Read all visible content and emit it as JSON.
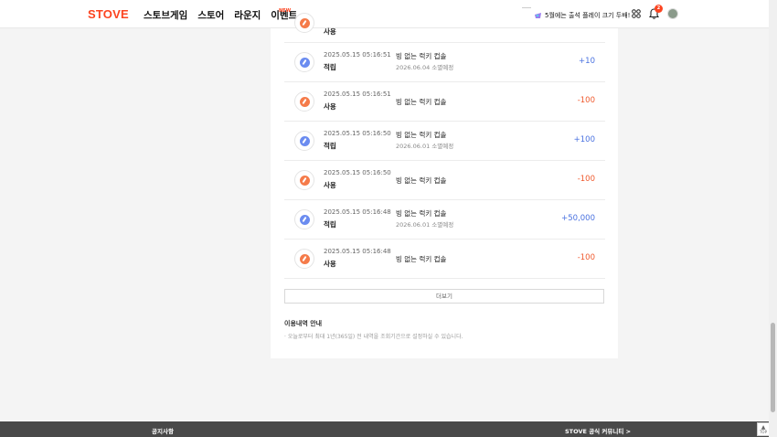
{
  "header": {
    "logo": "STOVE",
    "nav": [
      "스토브게임",
      "스토어",
      "라운지",
      "이벤트"
    ],
    "new_badge": "NEW",
    "promo_text": "5월에는 출석 플레이 크기 두배!",
    "notification_count": "2"
  },
  "transactions": [
    {
      "date": "2025.05.15 05:16:51",
      "type": "적립",
      "title": "빙 없는 럭키 컵솔",
      "sub": "2026.06.04 소멸예정",
      "amount": "+10",
      "kind": "earn"
    },
    {
      "date": "2025.05.15 05:16:51",
      "type": "사용",
      "title": "빙 없는 럭키 컵솔",
      "sub": "",
      "amount": "-100",
      "kind": "use"
    },
    {
      "date": "2025.05.15 05:16:50",
      "type": "적립",
      "title": "빙 없는 럭키 컵솔",
      "sub": "2026.06.01 소멸예정",
      "amount": "+100",
      "kind": "earn"
    },
    {
      "date": "2025.05.15 05:16:50",
      "type": "사용",
      "title": "빙 없는 럭키 컵솔",
      "sub": "",
      "amount": "-100",
      "kind": "use"
    },
    {
      "date": "2025.05.15 05:16:48",
      "type": "적립",
      "title": "빙 없는 럭키 컵솔",
      "sub": "2026.06.01 소멸예정",
      "amount": "+50,000",
      "kind": "earn"
    },
    {
      "date": "2025.05.15 05:16:48",
      "type": "사용",
      "title": "빙 없는 럭키 컵솔",
      "sub": "",
      "amount": "-100",
      "kind": "use"
    }
  ],
  "partial_row_type": "사용",
  "more_button": "더보기",
  "notice": {
    "title": "이용내역 안내",
    "items": [
      "오늘로부터 최대 1년(365일) 전 내역을 조회기간으로 설정하실 수 있습니다."
    ]
  },
  "footer": {
    "left": "공지사항",
    "right": "STOVE 공식 커뮤니티 >"
  },
  "top_button": "TOP"
}
